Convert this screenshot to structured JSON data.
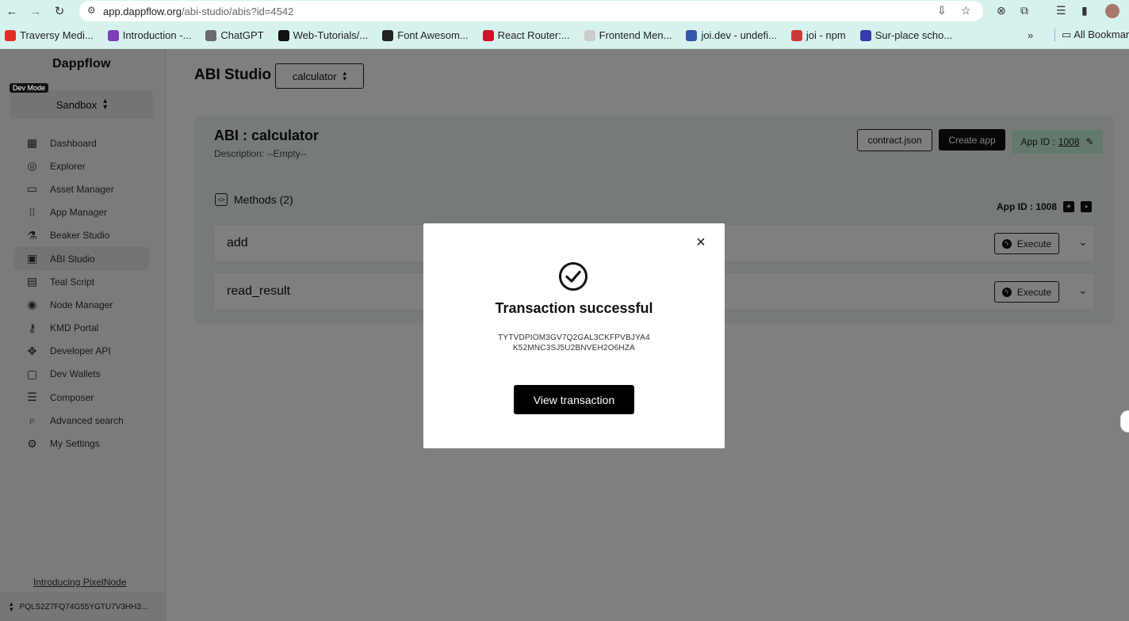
{
  "browser": {
    "url_host": "app.dappflow.org",
    "url_path": "/abi-studio/abis?id=4542",
    "bookmarks": [
      {
        "label": "Traversy Medi...",
        "color": "#e52d27"
      },
      {
        "label": "Introduction -...",
        "color": "#7b3fb8"
      },
      {
        "label": "ChatGPT",
        "color": "#6b6b6b"
      },
      {
        "label": "Web-Tutorials/...",
        "color": "#111111"
      },
      {
        "label": "Font Awesom...",
        "color": "#222222"
      },
      {
        "label": "React Router:...",
        "color": "#d0112b"
      },
      {
        "label": "Frontend Men...",
        "color": "#cccccc"
      },
      {
        "label": "joi.dev - undefi...",
        "color": "#3355aa"
      },
      {
        "label": "joi - npm",
        "color": "#cb3837"
      },
      {
        "label": "Sur-place scho...",
        "color": "#3a3aa8"
      }
    ],
    "bookmarks_more": "»",
    "bookmarks_folder": "All Bookmarks"
  },
  "sidebar": {
    "logo": "Dappflow",
    "dev_mode_label": "Dev Mode",
    "network": "Sandbox",
    "items": [
      {
        "label": "Dashboard",
        "icon": "▦",
        "active": false
      },
      {
        "label": "Explorer",
        "icon": "◎",
        "active": false
      },
      {
        "label": "Asset Manager",
        "icon": "▭",
        "active": false
      },
      {
        "label": "App Manager",
        "icon": "⁞⁞",
        "active": false
      },
      {
        "label": "Beaker Studio",
        "icon": "⚗",
        "active": false
      },
      {
        "label": "ABI Studio",
        "icon": "▣",
        "active": true
      },
      {
        "label": "Teal Script",
        "icon": "▤",
        "active": false
      },
      {
        "label": "Node Manager",
        "icon": "◉",
        "active": false
      },
      {
        "label": "KMD Portal",
        "icon": "⚷",
        "active": false
      },
      {
        "label": "Developer API",
        "icon": "✥",
        "active": false
      },
      {
        "label": "Dev Wallets",
        "icon": "▢",
        "active": false
      },
      {
        "label": "Composer",
        "icon": "☰",
        "active": false
      },
      {
        "label": "Advanced search",
        "icon": "⌕",
        "active": false
      },
      {
        "label": "My Settings",
        "icon": "⚙",
        "active": false
      }
    ],
    "introducing": "Introducing PixelNode",
    "account": "PQLS2Z7FQ74G55YGTU7V3HH3..."
  },
  "main": {
    "page_title": "ABI Studio",
    "selected_abi": "calculator",
    "abi_title": "ABI : calculator",
    "description": "Description: --Empty--",
    "contract_json_label": "contract.json",
    "create_app_label": "Create app",
    "app_id_prefix": "App ID :",
    "app_id_value": "1008",
    "methods_label": "Methods (2)",
    "app_id_right": "App ID : 1008",
    "methods": [
      {
        "name": "add",
        "execute_label": "Execute"
      },
      {
        "name": "read_result",
        "execute_label": "Execute"
      }
    ]
  },
  "modal": {
    "title": "Transaction successful",
    "tx_line1": "TYTVDPIOM3GV7Q2GAL3CKFPVBJYA4",
    "tx_line2": "K52MNC3SJ5U2BNVEH2O6HZA",
    "view_button": "View transaction",
    "close_icon": "×"
  }
}
